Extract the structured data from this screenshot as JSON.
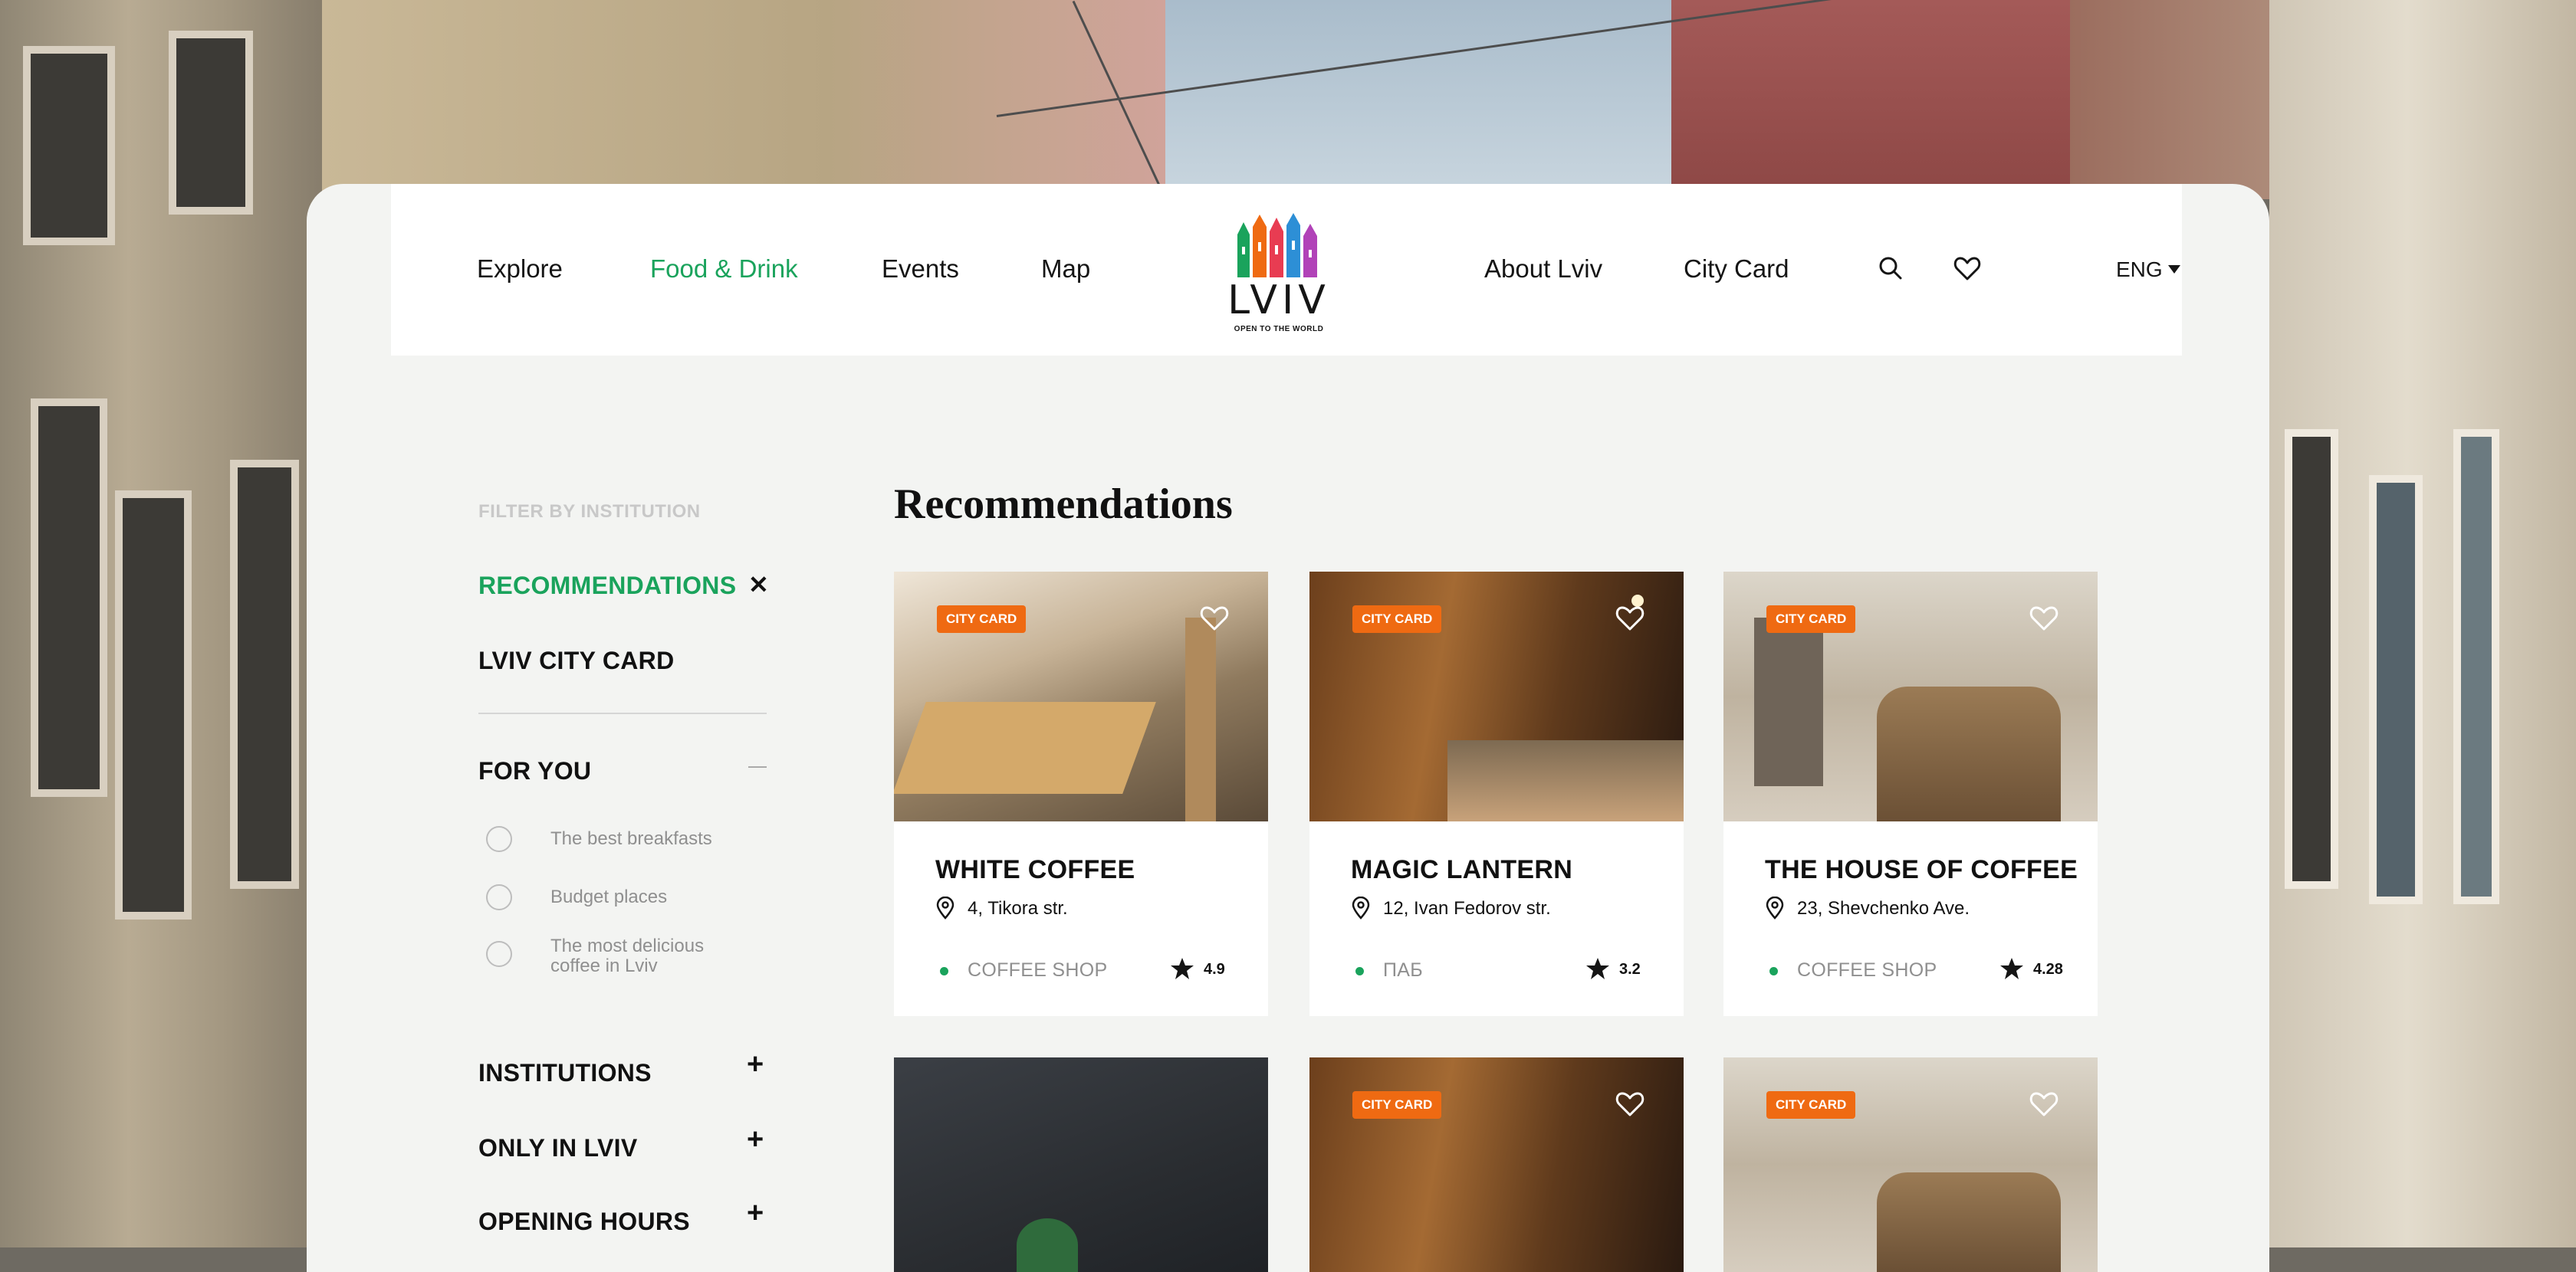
{
  "nav": {
    "left": [
      "Explore",
      "Food & Drink",
      "Events",
      "Map"
    ],
    "right": [
      "About Lviv",
      "City Card"
    ],
    "active_index": 1,
    "language": "ENG",
    "icons": [
      "search-icon",
      "heart-icon",
      "chevron-down-icon"
    ]
  },
  "logo": {
    "word": "LVIV",
    "tagline": "OPEN TO THE WORLD"
  },
  "sidebar": {
    "heading": "FILTER BY INSTITUTION",
    "active_filter": "RECOMMENDATIONS",
    "clear_symbol": "✕",
    "city_card_link": "LVIV CITY CARD",
    "for_you": {
      "title": "FOR YOU",
      "options": [
        "The best breakfasts",
        "Budget places",
        "The most delicious coffee in Lviv"
      ]
    },
    "sections": [
      "INSTITUTIONS",
      "ONLY IN LVIV",
      "OPENING HOURS"
    ],
    "expand_symbol": "+"
  },
  "main": {
    "title": "Recommendations",
    "badge_label": "CITY CARD",
    "cards": [
      {
        "name": "WHITE COFFEE",
        "address": "4, Tikora str.",
        "category": "COFFEE SHOP",
        "rating": "4.9",
        "badge": true
      },
      {
        "name": "MAGIC LANTERN",
        "address": "12, Ivan Fedorov str.",
        "category": "ПАБ",
        "rating": "3.2",
        "badge": true
      },
      {
        "name": "THE HOUSE OF COFFEE",
        "address": "23, Shevchenko Ave.",
        "category": "COFFEE SHOP",
        "rating": "4.28",
        "badge": true
      },
      {
        "badge": false
      },
      {
        "badge": true
      },
      {
        "badge": true
      }
    ]
  },
  "colors": {
    "accent": "#1aa35c",
    "badge": "#ef6a12",
    "sheet": "#f3f4f2"
  }
}
